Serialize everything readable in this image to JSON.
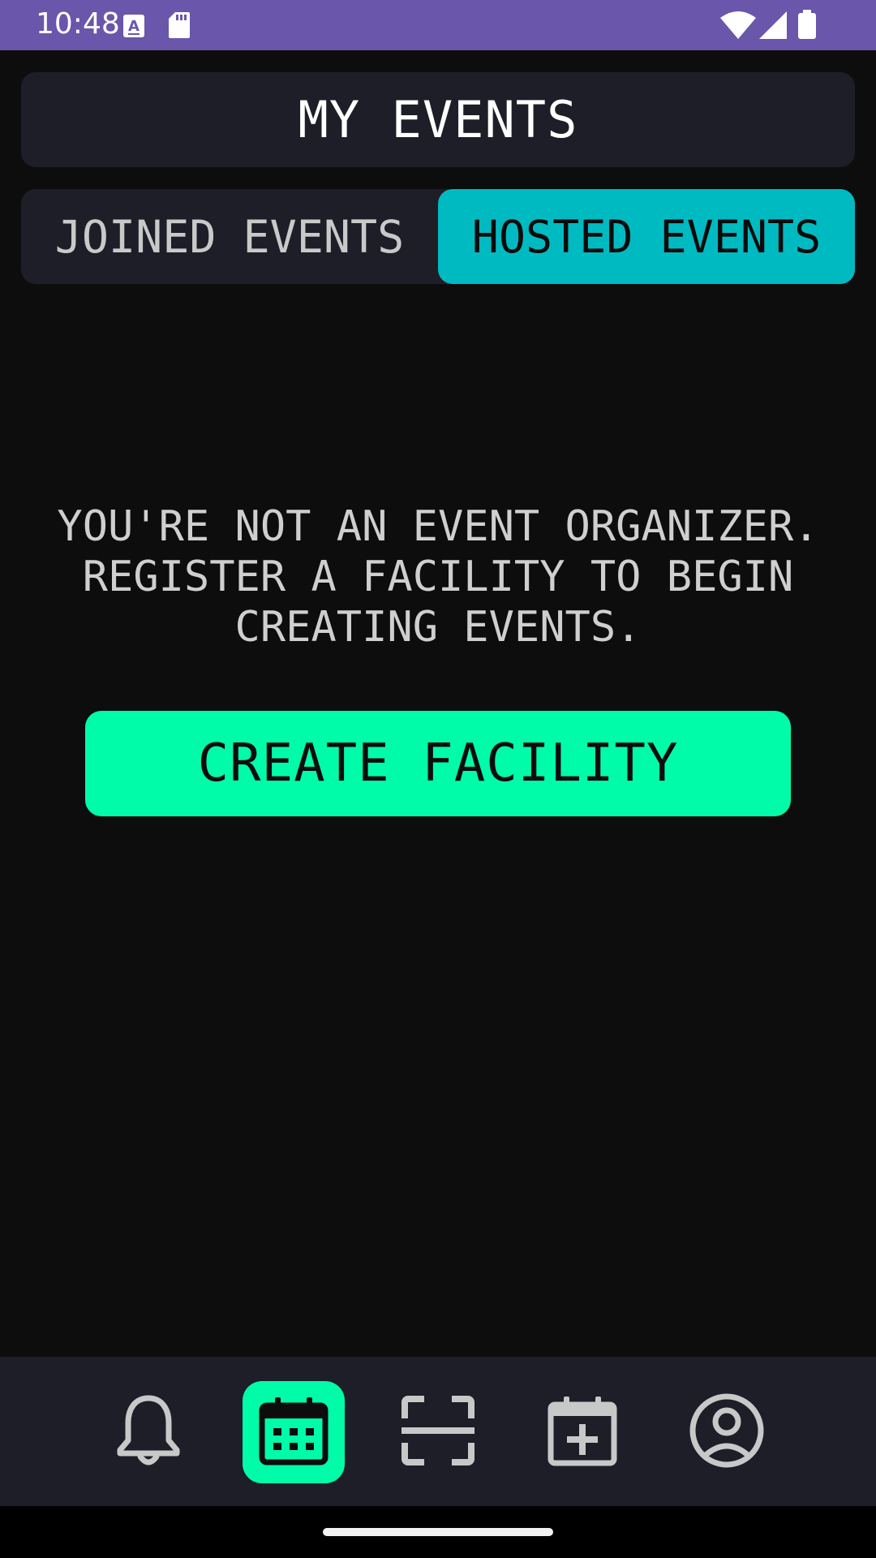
{
  "status_bar": {
    "time": "10:48",
    "bg_color": "#6a56aa",
    "icons": [
      "a-notification-icon",
      "sd-card-icon",
      "wifi-icon",
      "cell-signal-icon",
      "battery-icon"
    ]
  },
  "header": {
    "title": "MY EVENTS"
  },
  "tabs": [
    {
      "label": "JOINED EVENTS",
      "selected": false
    },
    {
      "label": "HOSTED EVENTS",
      "selected": true
    }
  ],
  "empty_state": {
    "message": "YOU'RE NOT AN EVENT ORGANIZER. REGISTER A FACILITY TO BEGIN CREATING EVENTS."
  },
  "create_button": {
    "label": "CREATE FACILITY"
  },
  "bottom_nav": {
    "items": [
      {
        "icon": "bell-icon",
        "active": false
      },
      {
        "icon": "calendar-icon",
        "active": true
      },
      {
        "icon": "scan-icon",
        "active": false
      },
      {
        "icon": "calendar-add-icon",
        "active": false
      },
      {
        "icon": "account-icon",
        "active": false
      }
    ]
  },
  "colors": {
    "background": "#0d0d0e",
    "surface": "#1d1e28",
    "tab_selected": "#00bac2",
    "accent": "#00fca8",
    "text_primary": "#ffffff",
    "text_secondary": "#cfcfcf",
    "icon_inactive": "#c8c8c8"
  }
}
